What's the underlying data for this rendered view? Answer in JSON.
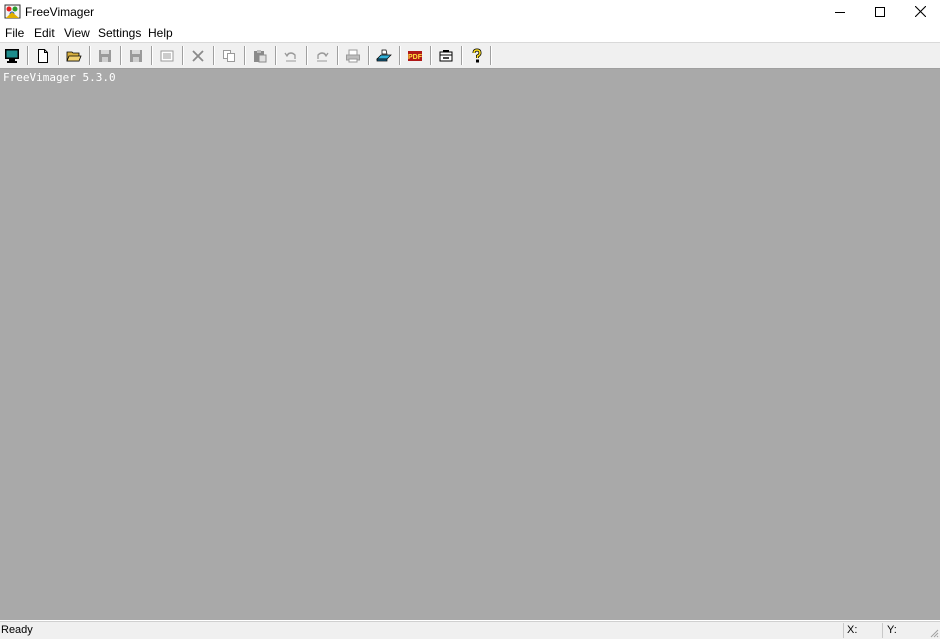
{
  "window": {
    "title": "FreeVimager"
  },
  "menu": [
    "File",
    "Edit",
    "View",
    "Settings",
    "Help"
  ],
  "toolbar": {
    "buttons": [
      {
        "icon": "monitor-icon",
        "enabled": true
      },
      {
        "icon": "new-document-icon",
        "enabled": true
      },
      {
        "icon": "open-folder-icon",
        "enabled": true
      },
      {
        "icon": "save-icon",
        "enabled": false
      },
      {
        "icon": "save-as-icon",
        "enabled": false
      },
      {
        "icon": "page-icon",
        "enabled": false
      },
      {
        "icon": "delete-icon",
        "enabled": false
      },
      {
        "icon": "copy-icon",
        "enabled": false
      },
      {
        "icon": "paste-icon",
        "enabled": false
      },
      {
        "icon": "undo-icon",
        "enabled": false
      },
      {
        "icon": "redo-icon",
        "enabled": false
      },
      {
        "icon": "print-icon",
        "enabled": false
      },
      {
        "icon": "scan-icon",
        "enabled": true
      },
      {
        "icon": "pdf-icon",
        "enabled": true
      },
      {
        "icon": "capture-icon",
        "enabled": true
      },
      {
        "icon": "help-icon",
        "enabled": true
      }
    ],
    "pdf_label": "PDF"
  },
  "workspace": {
    "version_text": "FreeVimager 5.3.0",
    "background": "#a9a9a9"
  },
  "status": {
    "text": "Ready",
    "x_label": "X:",
    "y_label": "Y:"
  }
}
